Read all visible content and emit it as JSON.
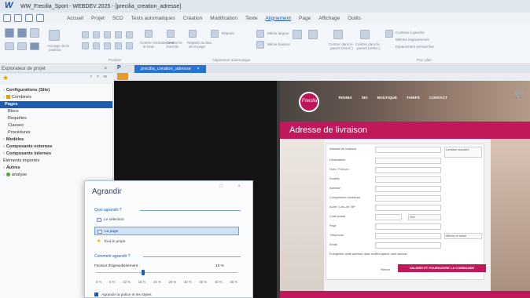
{
  "window": {
    "title": "WW_Frecilia_Sport - WEBDEV 2025 - [precilia_creation_adresse]"
  },
  "menu": {
    "items": [
      "Accueil",
      "Projet",
      "SCD",
      "Tests automatiques",
      "Création",
      "Modification",
      "Texte",
      "Alignement",
      "Page",
      "Affichage",
      "Outils"
    ],
    "active_index": 7
  },
  "ribbon": {
    "labels": [
      "Ancrage de la",
      "position",
      "Centrer verticalement",
      "le fond",
      "Centrer le",
      "fond de",
      "Répartir au bas",
      "de la page",
      "Répartir",
      "Même largeur",
      "Même hauteur",
      "Centrer dans le",
      "parent (Horiz.)",
      "Centrer dans le",
      "parent (Vertic.)",
      "Contenu à gauche",
      "Mêmes espacements",
      "Espacement vertical fixe"
    ],
    "groups": [
      "Position",
      "Alignement automatique",
      "Pos. plan"
    ]
  },
  "project_panel": {
    "title": "Explorateur de projet",
    "close": "×",
    "tree": [
      {
        "label": "Configurations (Site)",
        "bold": true
      },
      {
        "label": "Combinés",
        "bold": false
      },
      {
        "label": "Pages",
        "bold": true
      },
      {
        "label": "Blocs",
        "bold": false
      },
      {
        "label": "Requêtes",
        "bold": false
      },
      {
        "label": "Classes",
        "bold": false
      },
      {
        "label": "Procédures",
        "bold": false
      },
      {
        "label": "Modèles",
        "bold": true
      },
      {
        "label": "Composants externes",
        "bold": true
      },
      {
        "label": "Composants internes",
        "bold": true
      },
      {
        "label": "Éléments importés",
        "bold": false
      },
      {
        "label": "Autres",
        "bold": true
      },
      {
        "label": "analyse",
        "bold": false
      }
    ],
    "selected_index": 2
  },
  "editor": {
    "doc_tab": "precilia_creation_adresse",
    "tab_close": "×"
  },
  "preview": {
    "logo_text": "Frecilia",
    "nav": [
      "TENNIS",
      "SKI",
      "BOUTIQUE",
      "TARIFS",
      "CONTACT"
    ],
    "banner_title": "Adresse de livraison",
    "form_fields": [
      "Adresse de livraison",
      "Destinataire",
      "Nom / Prénom",
      "Société",
      "Adresse",
      "Complément d'adresse",
      "Autre / Lieu-dit / BP",
      "Code postal",
      "Pays",
      "Téléphone",
      "Email",
      "Enregistrer cette adresse dans mon carnet"
    ],
    "side_notes": [
      "Livraison standard",
      "CP",
      "Ville",
      "Afficher le détail",
      "Enregistrer cette adresse"
    ],
    "cancel": "Retour",
    "submit": "VALIDER ET POURSUIVRE LA COMMANDE"
  },
  "dialog": {
    "title": "Agrandir",
    "controls": "□ ×",
    "section1": "Quoi agrandir ?",
    "options": [
      "Le sélection",
      "La page",
      "Tout le projet"
    ],
    "selected_option_index": 1,
    "section2": "Comment agrandir ?",
    "factor_label": "Facteur d'agrandissement :",
    "factor_value": "15 %",
    "factor_percent": 15,
    "scale": [
      "0 %",
      "5 %",
      "10 %",
      "15 %",
      "20 %",
      "25 %",
      "30 %",
      "35 %",
      "40 %",
      "45 %"
    ],
    "checkbox_label": "Agrandir la police et les styles",
    "checkbox_checked": true
  }
}
